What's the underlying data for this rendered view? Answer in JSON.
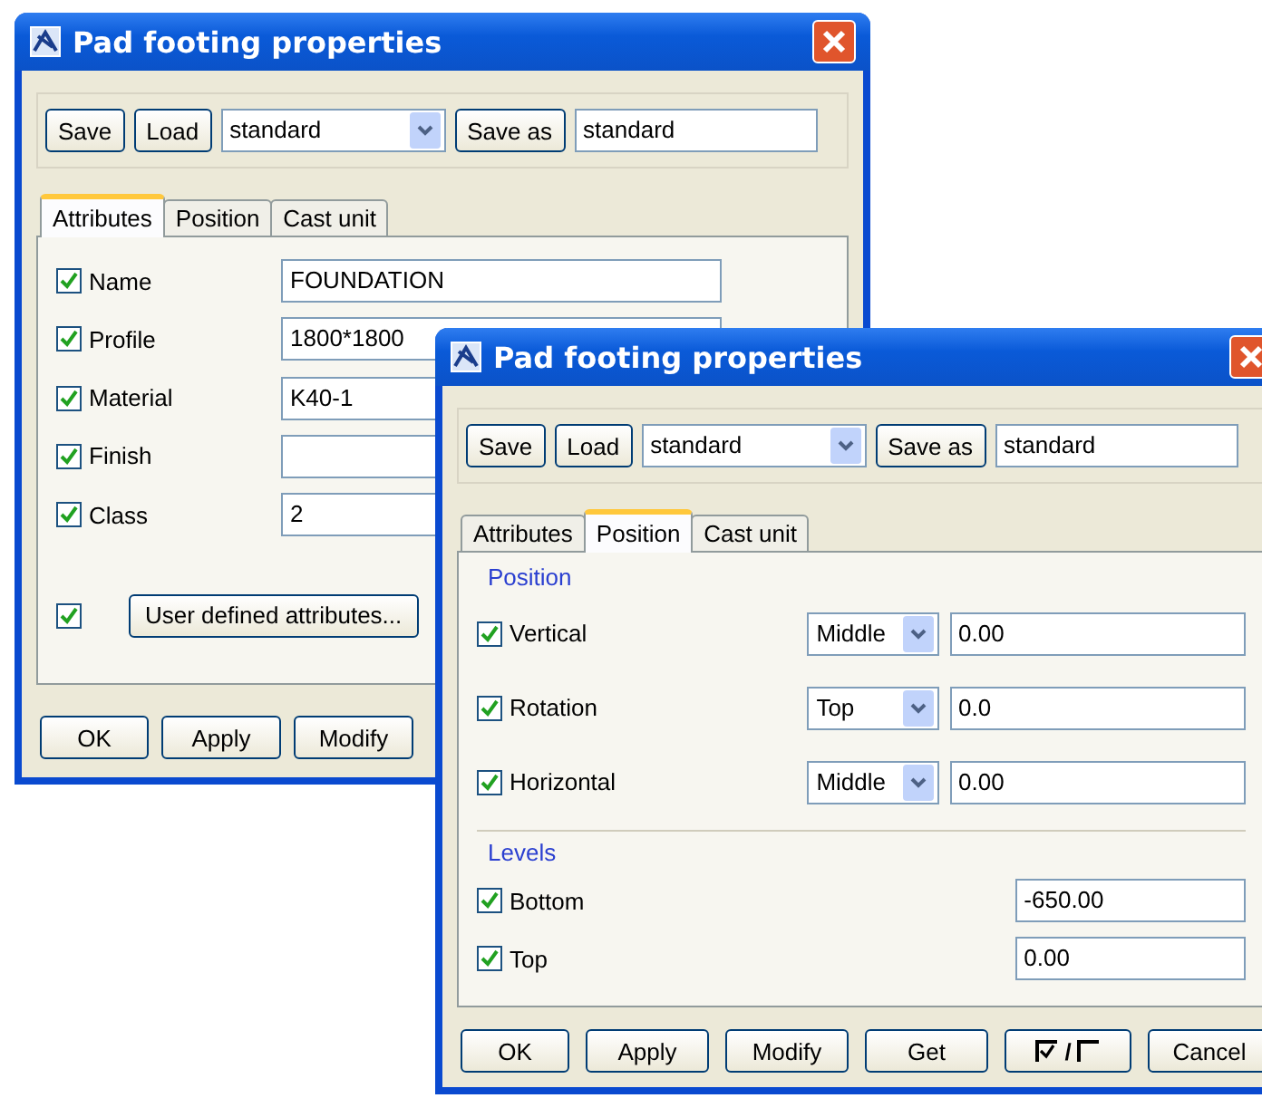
{
  "attributes_window": {
    "title": "Pad footing properties",
    "toolbar": {
      "save": "Save",
      "load": "Load",
      "preset": "standard",
      "save_as": "Save as",
      "save_as_name": "standard"
    },
    "tabs": [
      {
        "label": "Attributes",
        "selected": true
      },
      {
        "label": "Position",
        "selected": false
      },
      {
        "label": "Cast unit",
        "selected": false
      }
    ],
    "rows": [
      {
        "label": "Name",
        "checked": true,
        "value": "FOUNDATION"
      },
      {
        "label": "Profile",
        "checked": true,
        "value": "1800*1800"
      },
      {
        "label": "Material",
        "checked": true,
        "value": "K40-1"
      },
      {
        "label": "Finish",
        "checked": true,
        "value": ""
      },
      {
        "label": "Class",
        "checked": true,
        "value": "2"
      }
    ],
    "user_defined": {
      "checked": true,
      "label": "User defined attributes..."
    },
    "buttons": [
      "OK",
      "Apply",
      "Modify"
    ]
  },
  "position_window": {
    "title": "Pad footing properties",
    "toolbar": {
      "save": "Save",
      "load": "Load",
      "preset": "standard",
      "save_as": "Save as",
      "save_as_name": "standard"
    },
    "tabs": [
      {
        "label": "Attributes",
        "selected": false
      },
      {
        "label": "Position",
        "selected": true
      },
      {
        "label": "Cast unit",
        "selected": false
      }
    ],
    "sections": [
      {
        "heading": "Position",
        "rows": [
          {
            "kind": "dropdown",
            "label": "Vertical",
            "checked": true,
            "option": "Middle",
            "value": "0.00"
          },
          {
            "kind": "dropdown",
            "label": "Rotation",
            "checked": true,
            "option": "Top",
            "value": "0.0"
          },
          {
            "kind": "dropdown",
            "label": "Horizontal",
            "checked": true,
            "option": "Middle",
            "value": "0.00"
          }
        ]
      },
      {
        "heading": "Levels",
        "rows": [
          {
            "kind": "plain",
            "label": "Bottom",
            "checked": true,
            "value": "-650.00"
          },
          {
            "kind": "plain",
            "label": "Top",
            "checked": true,
            "value": "0.00"
          }
        ]
      }
    ],
    "buttons": [
      {
        "kind": "text",
        "label": "OK"
      },
      {
        "kind": "text",
        "label": "Apply"
      },
      {
        "kind": "text",
        "label": "Modify"
      },
      {
        "kind": "text",
        "label": "Get"
      },
      {
        "kind": "toggle",
        "label": "/"
      },
      {
        "kind": "text",
        "label": "Cancel"
      }
    ]
  }
}
